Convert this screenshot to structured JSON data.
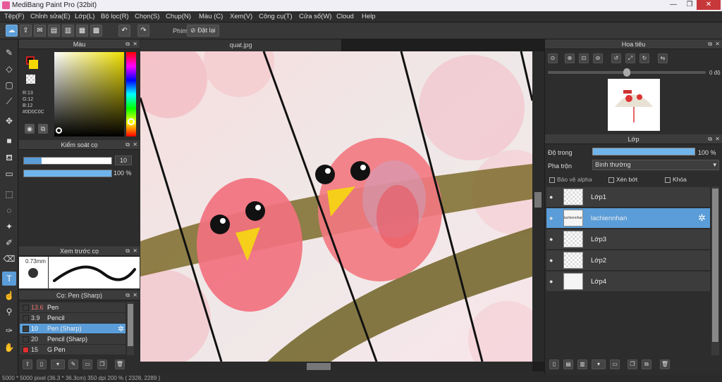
{
  "app": {
    "title": "MediBang Paint Pro (32bit)"
  },
  "window_controls": {
    "minimize": "—",
    "restore": "❐",
    "close": "✕"
  },
  "menu": [
    "Tệp(F)",
    "Chỉnh sửa(E)",
    "Lớp(L)",
    "Bộ lọc(R)",
    "Chọn(S)",
    "Chụp(N)",
    "Màu (C)",
    "Xem(V)",
    "Công cụ(T)",
    "Cửa sổ(W)",
    "Cloud",
    "Help"
  ],
  "toolbar": {
    "filter_label": "Phím",
    "reset_label": "Đặt lại"
  },
  "color_panel": {
    "title": "Màu",
    "r": "R:13",
    "g": "G:12",
    "b": "B:12",
    "hex": "#0D0C0C",
    "fg_color": "#0d0c0c",
    "bg_color": "#f5d800"
  },
  "brush_control": {
    "title": "Kiểm soát cọ",
    "size": "10",
    "size_fill": 0.2,
    "opacity": "100 %",
    "opacity_fill": 1.0
  },
  "brush_preview": {
    "title": "Xem trước cọ",
    "size_label": "0.73mm"
  },
  "brush_list": {
    "title": "Cọ: Pen (Sharp)",
    "items": [
      {
        "size": "13.6",
        "name": "Pen",
        "color": "#3a3a3a",
        "size_color": "#f07070"
      },
      {
        "size": "3.9",
        "name": "Pencil",
        "color": "#3a3a3a",
        "size_color": "#ddd"
      },
      {
        "size": "10",
        "name": "Pen (Sharp)",
        "color": "#3a3a3a",
        "size_color": "#fff",
        "selected": true
      },
      {
        "size": "20",
        "name": "Pencil (Sharp)",
        "color": "#3a3a3a",
        "size_color": "#ddd"
      },
      {
        "size": "15",
        "name": "G Pen",
        "color": "#e03030",
        "size_color": "#ddd"
      }
    ]
  },
  "canvas": {
    "tab_title": "quat.jpg"
  },
  "navigator": {
    "title": "Hoa tiêu",
    "zoom": "0 độ"
  },
  "layers_panel": {
    "title": "Lớp",
    "opacity_label": "Độ trong",
    "opacity_value": "100 %",
    "blend_label": "Pha trộn",
    "blend_value": "Bình thường",
    "protect_alpha": "Bảo vệ alpha",
    "clipping": "Xén bớt",
    "lock": "Khóa",
    "layers": [
      {
        "name": "Lớp1",
        "selected": false
      },
      {
        "name": "lachiennhan",
        "selected": true,
        "thumb_text": "lachiennhan"
      },
      {
        "name": "Lớp3",
        "selected": false
      },
      {
        "name": "Lớp2",
        "selected": false
      },
      {
        "name": "Lớp4",
        "selected": false
      }
    ]
  },
  "status": {
    "text": "5000 * 5000 pixel   (36.3 * 36.3cm)   350 dpi   200 %   ( 2328, 2289 )"
  }
}
